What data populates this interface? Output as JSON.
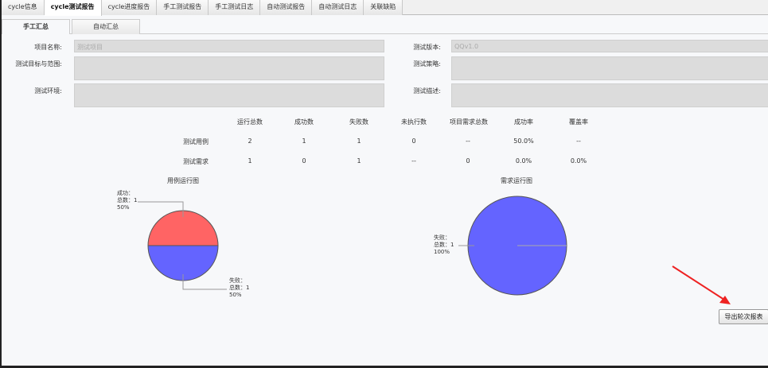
{
  "tabs": [
    "cycle信息",
    "cycle测试报告",
    "cycle进度报告",
    "手工测试报告",
    "手工测试日志",
    "自动测试报告",
    "自动测试日志",
    "关联缺陷"
  ],
  "subtabs": [
    "手工汇总",
    "自动汇总"
  ],
  "form": {
    "project_name_label": "项目名称:",
    "project_name_value": "测试项目",
    "goal_label": "测试目标与范围:",
    "env_label": "测试环境:",
    "version_label": "测试版本:",
    "version_value": "QQv1.0",
    "strategy_label": "测试策略:",
    "desc_label": "测试描述:"
  },
  "table": {
    "headers": [
      "运行总数",
      "成功数",
      "失败数",
      "未执行数",
      "项目需求总数",
      "成功率",
      "覆盖率"
    ],
    "rows": [
      {
        "label": "测试用例",
        "values": [
          "2",
          "1",
          "1",
          "0",
          "--",
          "50.0%",
          "--"
        ]
      },
      {
        "label": "测试需求",
        "values": [
          "1",
          "0",
          "1",
          "--",
          "0",
          "0.0%",
          "0.0%"
        ]
      }
    ]
  },
  "chart_data": [
    {
      "type": "pie",
      "title": "用例运行图",
      "slices": [
        {
          "name": "成功",
          "count_label": "总数：1",
          "count": 1,
          "percent": "50%",
          "color": "#ff6464"
        },
        {
          "name": "失败",
          "count_label": "总数：1",
          "count": 1,
          "percent": "50%",
          "color": "#6464ff"
        }
      ]
    },
    {
      "type": "pie",
      "title": "需求运行图",
      "slices": [
        {
          "name": "失败",
          "count_label": "总数：1",
          "count": 1,
          "percent": "100%",
          "color": "#6464ff"
        }
      ]
    }
  ],
  "export_button": "导出轮次报表"
}
